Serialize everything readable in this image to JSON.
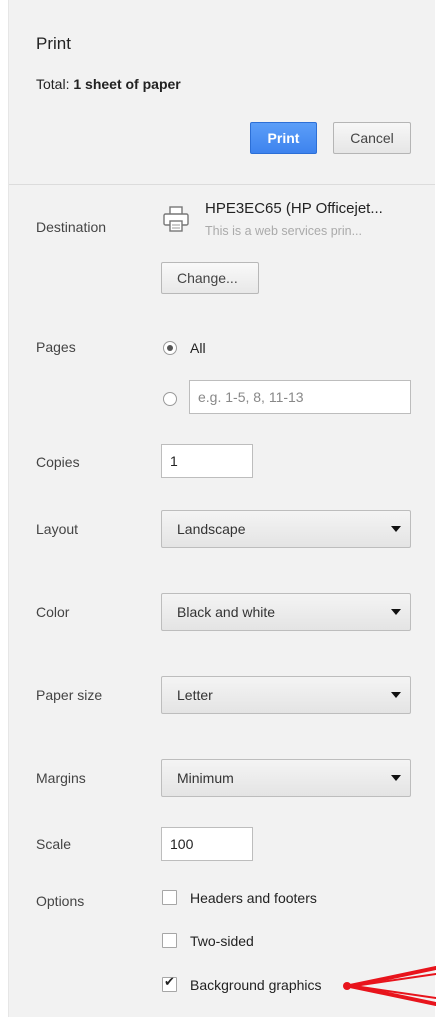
{
  "header": {
    "title": "Print",
    "summary_label": "Total:",
    "summary_value": "1 sheet of paper",
    "print_button": "Print",
    "cancel_button": "Cancel"
  },
  "destination": {
    "label": "Destination",
    "name": "HPE3EC65 (HP Officejet...",
    "description": "This is a web services prin...",
    "change_button": "Change...",
    "icon": "printer-icon"
  },
  "pages": {
    "label": "Pages",
    "all_option": "All",
    "all_selected": true,
    "range_placeholder": "e.g. 1-5, 8, 11-13"
  },
  "copies": {
    "label": "Copies",
    "value": "1"
  },
  "layout": {
    "label": "Layout",
    "value": "Landscape"
  },
  "color": {
    "label": "Color",
    "value": "Black and white"
  },
  "paper_size": {
    "label": "Paper size",
    "value": "Letter"
  },
  "margins": {
    "label": "Margins",
    "value": "Minimum"
  },
  "scale": {
    "label": "Scale",
    "value": "100"
  },
  "options": {
    "label": "Options",
    "items": [
      {
        "label": "Headers and footers",
        "checked": false
      },
      {
        "label": "Two-sided",
        "checked": false
      },
      {
        "label": "Background graphics",
        "checked": true
      }
    ]
  },
  "colors": {
    "primary_button": "#3e83ee",
    "panel_background": "#f2f2f2",
    "annotation_arrow": "#e8141c"
  }
}
